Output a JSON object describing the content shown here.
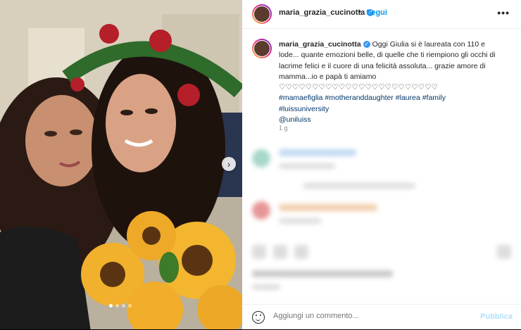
{
  "post": {
    "username": "maria_grazia_cucinotta",
    "verified_mark": "✓",
    "follow_label": "Segui",
    "separator": "•",
    "more_label": "•••"
  },
  "caption": {
    "username": "maria_grazia_cucinotta",
    "text": "Oggi Giulia si è laureata con 110 e lode... quante emozioni belle, di quelle che ti riempiono gli occhi di lacrime felici e il cuore di una felicità assoluta... grazie amore di mamma...io e papà ti amiamo",
    "hearts": "♡♡♡♡♡♡♡♡♡♡♡♡♡♡♡♡♡♡♡♡♡♡♡♡",
    "hashtags_line1": "#mamaefiglia #motheranddaughter #laurea #family",
    "hashtags_line2": "#luissuniversity",
    "mention": "@uniluiss",
    "time": "1 g"
  },
  "carousel": {
    "next_icon": "›",
    "slide_count": 4,
    "active_slide": 1
  },
  "comment_box": {
    "placeholder": "Aggiungi un commento...",
    "publish_label": "Pubblica"
  },
  "colors": {
    "link": "#0095f6",
    "hashtag": "#00376b",
    "publish_disabled": "#b2dffc"
  }
}
